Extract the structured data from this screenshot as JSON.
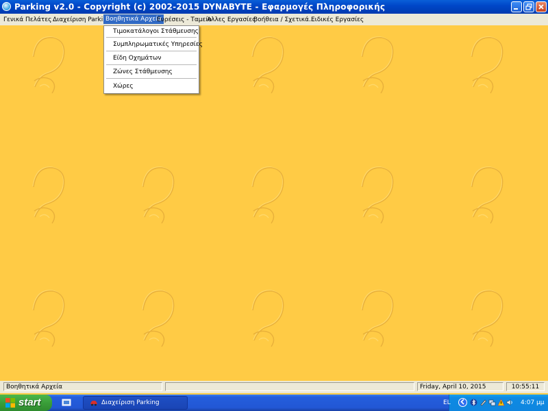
{
  "window": {
    "title": "Parking  v2.0   -   Copyright (c) 2002-2015  DYNABYTE - Εφαρμογές Πληροφορικής",
    "minimize_icon": "minimize-icon",
    "maximize_icon": "restore-icon",
    "close_icon": "close-icon"
  },
  "menubar": {
    "items": [
      {
        "label": "Γενικά"
      },
      {
        "label": "Πελάτες"
      },
      {
        "label": "Διαχείριση Parking"
      },
      {
        "label": "Βοηθητικά Αρχεία"
      },
      {
        "label": "Ευρέσεις - Ταμείο"
      },
      {
        "label": "Αλλες Εργασίες"
      },
      {
        "label": "Βοήθεια / Σχετικά..."
      },
      {
        "label": "Ειδικές Εργασίες"
      }
    ],
    "active_index": 3
  },
  "dropdown": {
    "items": [
      {
        "label": "Τιμοκατάλογοι Στάθμευσης"
      },
      {
        "label": "Συμπληρωματικές Υπηρεσίες"
      },
      {
        "label": "Είδη Οχημάτων"
      },
      {
        "label": "Ζώνες Στάθμευσης"
      },
      {
        "label": "Χώρες"
      }
    ]
  },
  "statusbar": {
    "hint": "Βοηθητικά Αρχεία",
    "middle": "",
    "date": "Friday, April 10, 2015",
    "time": "10:55:11"
  },
  "taskbar": {
    "start_label": "start",
    "task_label": "Διαχείριση Parking",
    "language": "EL",
    "clock": "4:07 μμ"
  },
  "colors": {
    "desktop_background": "#ffcb45",
    "menu_highlight": "#316ac5",
    "title_bar": "#0047c8"
  }
}
